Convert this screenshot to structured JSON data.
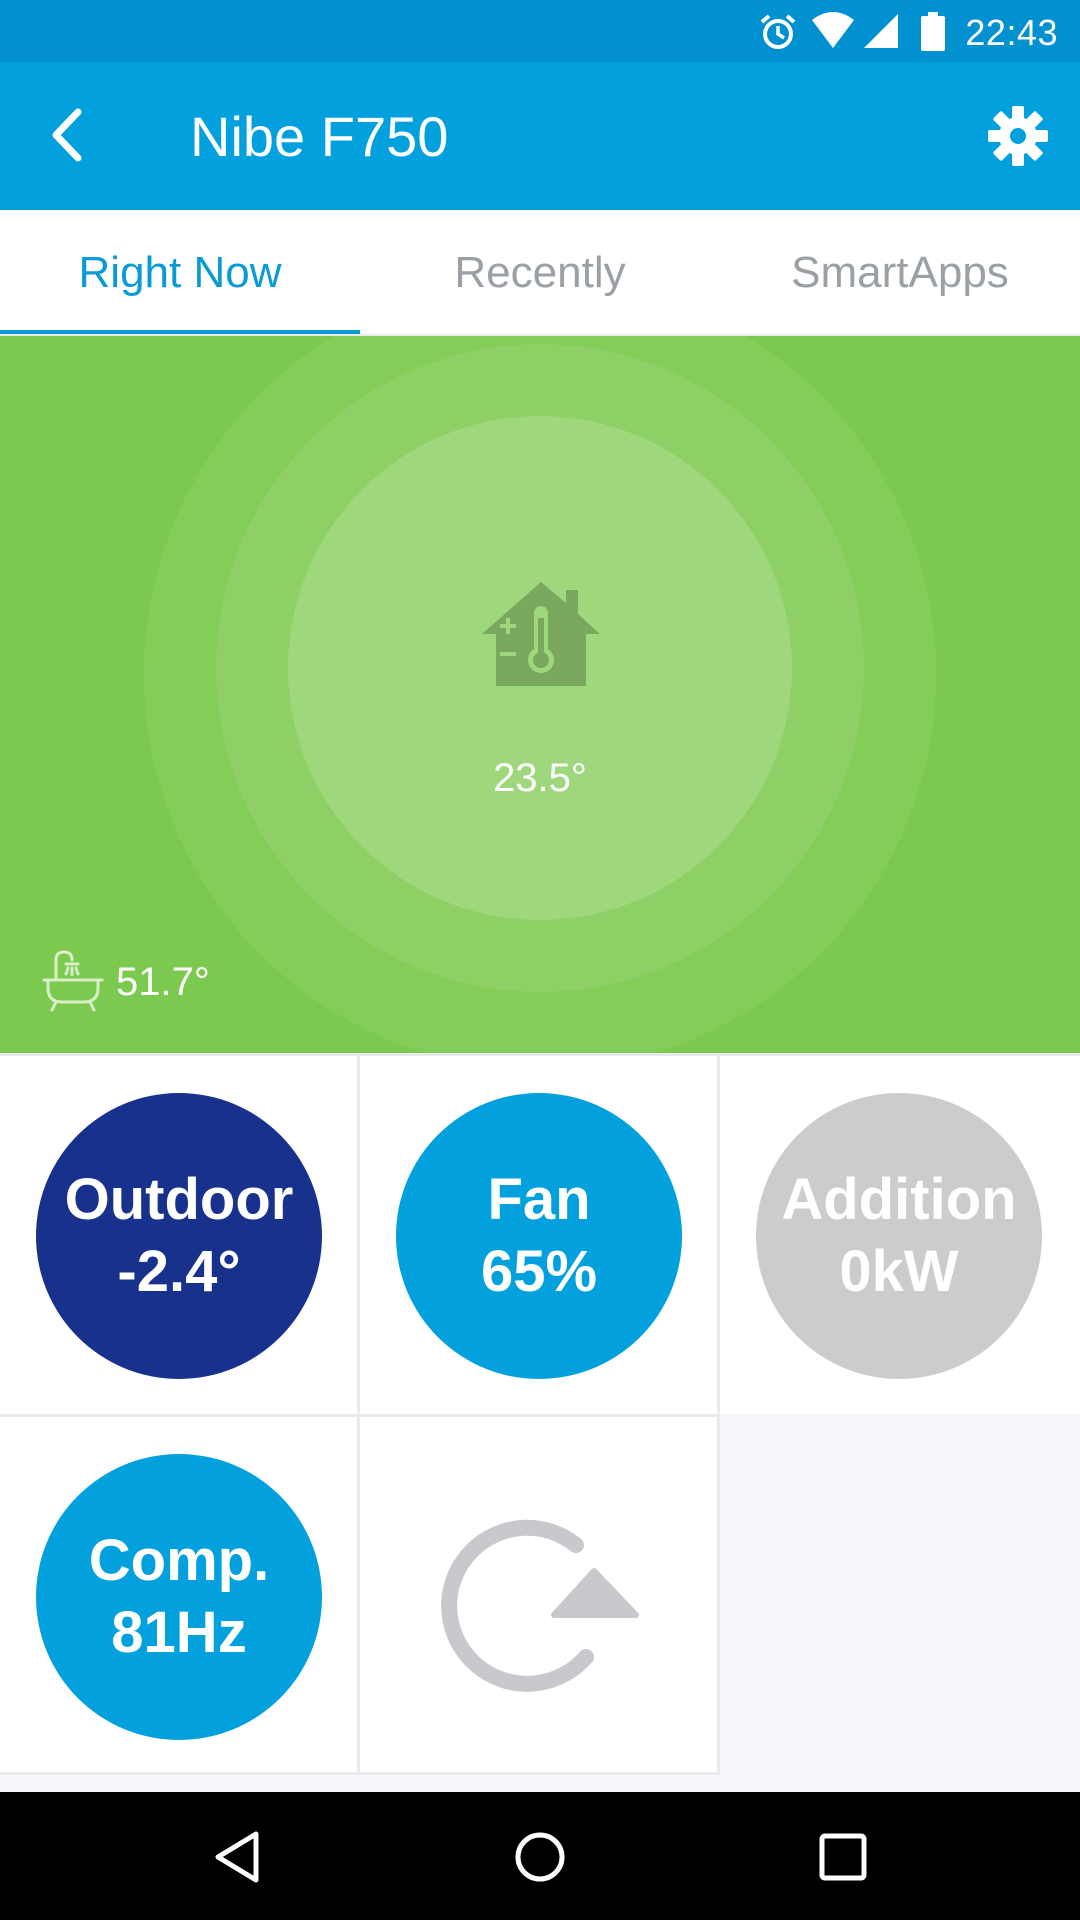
{
  "status_bar": {
    "time": "22:43"
  },
  "app_bar": {
    "title": "Nibe F750"
  },
  "tabs": [
    {
      "label": "Right Now",
      "active": true
    },
    {
      "label": "Recently",
      "active": false
    },
    {
      "label": "SmartApps",
      "active": false
    }
  ],
  "hero": {
    "indoor_temp": "23.5°",
    "hot_water_temp": "51.7°"
  },
  "tiles": [
    {
      "line1": "Outdoor",
      "line2": "-2.4°",
      "color": "#18318c"
    },
    {
      "line1": "Fan",
      "line2": "65%",
      "color": "#02a1dd"
    },
    {
      "line1": "Addition",
      "line2": "0kW",
      "color": "#cccccc"
    },
    {
      "line1": "Comp.",
      "line2": "81Hz",
      "color": "#02a1dd"
    }
  ],
  "colors": {
    "accent": "#0a9ad8",
    "app_bar": "#02a1dd",
    "hero_green": "#7cc94f"
  },
  "icons": [
    "back-arrow-icon",
    "settings-gear-icon",
    "house-thermometer-icon",
    "bathtub-icon",
    "refresh-icon"
  ]
}
